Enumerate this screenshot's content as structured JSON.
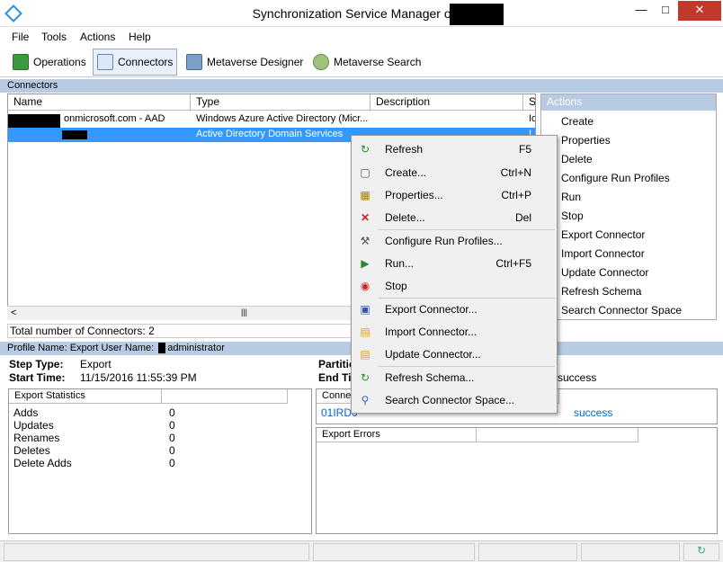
{
  "window": {
    "title": "Synchronization Service Manager on C"
  },
  "menubar": [
    "File",
    "Tools",
    "Actions",
    "Help"
  ],
  "toolbar": {
    "operations": "Operations",
    "connectors": "Connectors",
    "metaverse_designer": "Metaverse Designer",
    "metaverse_search": "Metaverse Search"
  },
  "connectors": {
    "section": "Connectors",
    "columns": [
      "Name",
      "Type",
      "Description",
      "S"
    ],
    "rows": [
      {
        "name": "onmicrosoft.com - AAD",
        "type": "Windows Azure Active Directory (Micr...",
        "description": "",
        "state": "Id"
      },
      {
        "name": "",
        "type": "Active Directory Domain Services",
        "description": "",
        "state": "I"
      }
    ],
    "total": "Total number of Connectors: 2"
  },
  "actions": {
    "header": "Actions",
    "items": [
      "Create",
      "Properties",
      "Delete",
      "Configure Run Profiles",
      "Run",
      "Stop",
      "Export Connector",
      "Import Connector",
      "Update Connector",
      "Refresh Schema",
      "Search Connector Space"
    ]
  },
  "context_menu": {
    "items": [
      {
        "label": "Refresh",
        "shortcut": "F5",
        "icon": "refresh-icon"
      },
      {
        "label": "Create...",
        "shortcut": "Ctrl+N",
        "icon": "create-icon"
      },
      {
        "label": "Properties...",
        "shortcut": "Ctrl+P",
        "icon": "properties-icon"
      },
      {
        "label": "Delete...",
        "shortcut": "Del",
        "icon": "delete-icon"
      },
      {
        "label": "Configure Run Profiles...",
        "shortcut": "",
        "icon": "tools-icon"
      },
      {
        "label": "Run...",
        "shortcut": "Ctrl+F5",
        "icon": "run-icon"
      },
      {
        "label": "Stop",
        "shortcut": "",
        "icon": "stop-icon"
      },
      {
        "label": "Export Connector...",
        "shortcut": "",
        "icon": "save-icon"
      },
      {
        "label": "Import Connector...",
        "shortcut": "",
        "icon": "folder-icon"
      },
      {
        "label": "Update Connector...",
        "shortcut": "",
        "icon": "folder-icon"
      },
      {
        "label": "Refresh Schema...",
        "shortcut": "",
        "icon": "refresh-icon"
      },
      {
        "label": "Search Connector Space...",
        "shortcut": "",
        "icon": "search-icon"
      }
    ]
  },
  "profile": {
    "label": "Profile Name: Export  User Name:",
    "user": "administrator",
    "step_type_label": "Step Type:",
    "step_type": "Export",
    "start_time_label": "Start Time:",
    "start_time": "11/15/2016 11:55:39 PM",
    "partition_label": "Partitic",
    "end_time_label": "End Tir",
    "status": "success"
  },
  "export_stats": {
    "header": "Export Statistics",
    "rows": [
      {
        "label": "Adds",
        "value": "0"
      },
      {
        "label": "Updates",
        "value": "0"
      },
      {
        "label": "Renames",
        "value": "0"
      },
      {
        "label": "Deletes",
        "value": "0"
      },
      {
        "label": "Delete Adds",
        "value": "0"
      }
    ]
  },
  "connection": {
    "header": "Conne",
    "link": "01IRD0",
    "status": "success"
  },
  "export_errors": {
    "header": "Export Errors"
  }
}
